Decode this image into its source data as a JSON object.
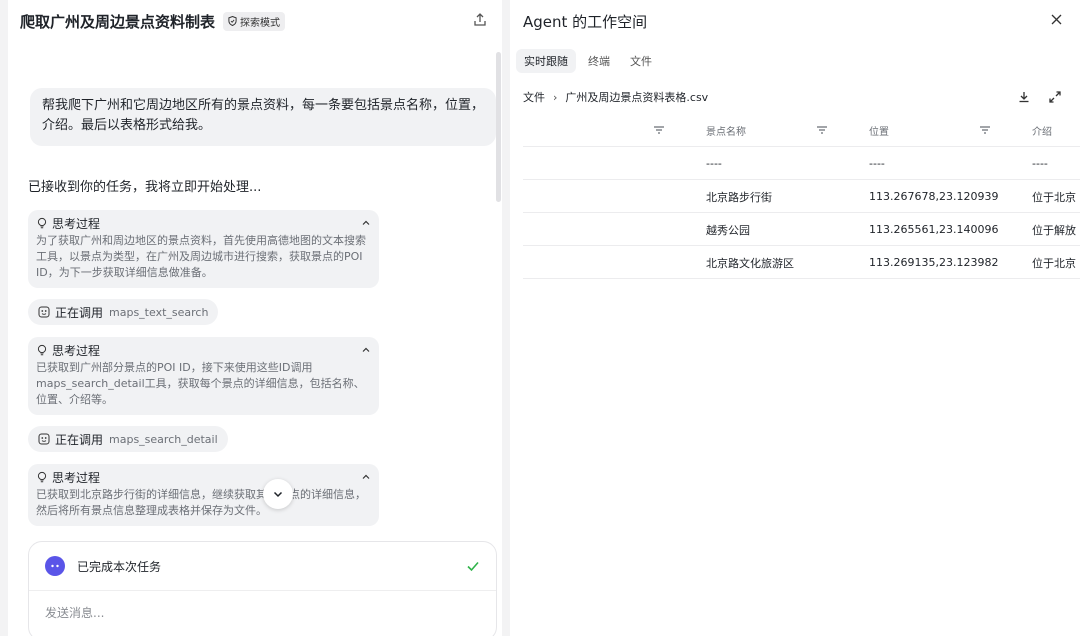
{
  "left": {
    "title": "爬取广州及周边景点资料制表",
    "badge": "探索模式",
    "user_message": "帮我爬下广州和它周边地区所有的景点资料，每一条要包括景点名称，位置，介绍。最后以表格形式给我。",
    "ack": "已接收到你的任务，我将立即开始处理...",
    "steps": [
      {
        "type": "think",
        "title": "思考过程",
        "text": "为了获取广州和周边地区的景点资料，首先使用高德地图的文本搜索工具，以景点为类型，在广州及周边城市进行搜索，获取景点的POI ID，为下一步获取详细信息做准备。"
      },
      {
        "type": "tool",
        "label": "正在调用",
        "name": "maps_text_search"
      },
      {
        "type": "think",
        "title": "思考过程",
        "text": "已获取到广州部分景点的POI ID，接下来使用这些ID调用maps_search_detail工具，获取每个景点的详细信息，包括名称、位置、介绍等。"
      },
      {
        "type": "tool",
        "label": "正在调用",
        "name": "maps_search_detail"
      },
      {
        "type": "think",
        "title": "思考过程",
        "text": "已获取到北京路步行街的详细信息，继续获取其他景点的详细信息，然后将所有景点信息整理成表格并保存为文件。"
      }
    ],
    "composer": {
      "status": "已完成本次任务",
      "placeholder": "发送消息..."
    }
  },
  "right": {
    "title": "Agent 的工作空间",
    "tabs": [
      "实时跟随",
      "终端",
      "文件"
    ],
    "active_tab": 0,
    "breadcrumb": [
      "文件",
      "广州及周边景点资料表格.csv"
    ],
    "table": {
      "headers": [
        "",
        "景点名称",
        "位置",
        "介绍"
      ],
      "rows": [
        [
          "",
          "----",
          "----",
          "----"
        ],
        [
          "",
          "北京路步行街",
          "113.267678,23.120939",
          "位于北京"
        ],
        [
          "",
          "越秀公园",
          "113.265561,23.140096",
          "位于解放"
        ],
        [
          "",
          "北京路文化旅游区",
          "113.269135,23.123982",
          "位于北京"
        ]
      ]
    }
  },
  "colors": {
    "accent": "#5a55e8",
    "success": "#2fb34a",
    "bubble": "#f1f2f4"
  }
}
